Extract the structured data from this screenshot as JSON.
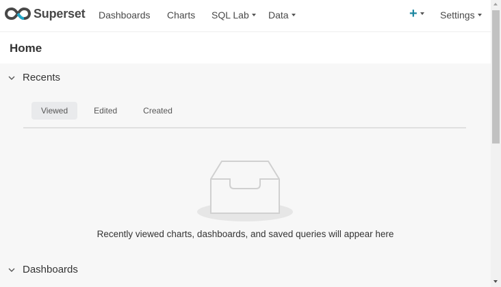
{
  "app": {
    "name": "Superset"
  },
  "nav": {
    "dashboards": "Dashboards",
    "charts": "Charts",
    "sql_lab": "SQL Lab",
    "data": "Data",
    "plus": "+",
    "settings": "Settings"
  },
  "page": {
    "title": "Home"
  },
  "recents": {
    "title": "Recents",
    "tabs": [
      "Viewed",
      "Edited",
      "Created"
    ],
    "active_tab": "Viewed",
    "empty_message": "Recently viewed charts, dashboards, and saved queries will appear here"
  },
  "dashboards": {
    "title": "Dashboards"
  },
  "colors": {
    "accent": "#1a85a0",
    "brand_text": "#484848",
    "tab_active_bg": "#e9eaec"
  }
}
